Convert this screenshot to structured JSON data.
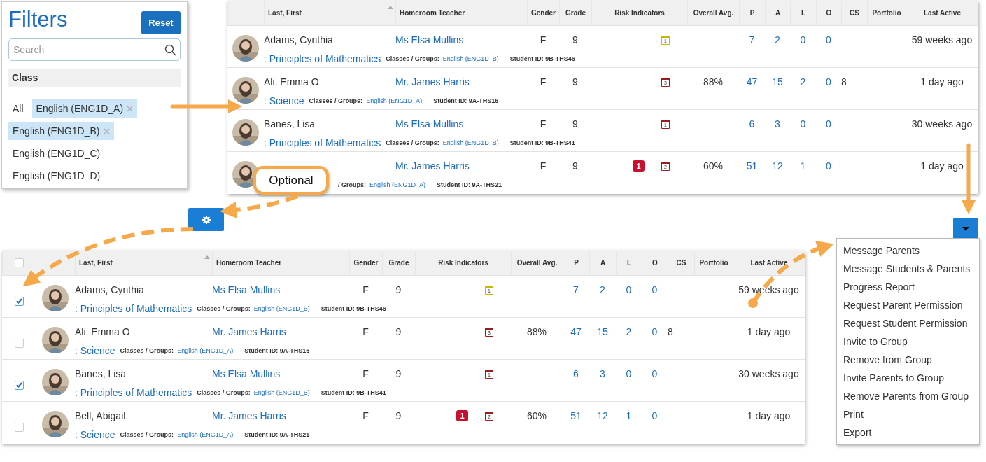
{
  "filters": {
    "title": "Filters",
    "reset_button": "Reset",
    "search": {
      "placeholder": "Search"
    },
    "section": "Class",
    "options": [
      {
        "label": "All",
        "selected": false
      },
      {
        "label": "English (ENG1D_A)",
        "selected": true
      },
      {
        "label": "English (ENG1D_B)",
        "selected": true
      },
      {
        "label": "English (ENG1D_C)",
        "selected": false
      },
      {
        "label": "English (ENG1D_D)",
        "selected": false
      }
    ]
  },
  "top_table": {
    "columns": [
      "Last, First",
      "Homeroom Teacher",
      "Gender",
      "Grade",
      "Risk Indicators",
      "Overall Avg.",
      "P",
      "A",
      "L",
      "O",
      "CS",
      "Portfolio",
      "Last Active"
    ],
    "rows": [
      {
        "name": "Adams, Cynthia",
        "teacher": "Ms Elsa Mullins",
        "gender": "F",
        "grade": "9",
        "calendar": {
          "count": "1",
          "color": "#c9b800"
        },
        "p": "7",
        "a": "2",
        "l": "0",
        "o": "0",
        "last_active": "59 weeks ago",
        "course": ": Principles of Mathematics",
        "classes_label": "Classes / Groups:",
        "class": "English (ENG1D_B)",
        "student_id": "Student ID: 9B-THS46"
      },
      {
        "name": "Ali, Emma O",
        "teacher": "Mr. James Harris",
        "gender": "F",
        "grade": "9",
        "calendar": {
          "count": "3",
          "color": "#9b1c1c"
        },
        "avg": "88%",
        "p": "47",
        "a": "15",
        "l": "2",
        "o": "0",
        "cs": "8",
        "last_active": "1 day ago",
        "course": ": Science",
        "classes_label": "Classes / Groups:",
        "class": "English (ENG1D_A)",
        "student_id": "Student ID: 9A-THS16"
      },
      {
        "name": "Banes, Lisa",
        "teacher": "Ms Elsa Mullins",
        "gender": "F",
        "grade": "9",
        "calendar": {
          "count": "1",
          "color": "#9b1c1c"
        },
        "p": "6",
        "a": "3",
        "l": "0",
        "o": "0",
        "last_active": "30 weeks ago",
        "course": ": Principles of Mathematics",
        "classes_label": "Classes / Groups:",
        "class": "English (ENG1D_B)",
        "student_id": "Student ID: 9B-THS41"
      },
      {
        "teacher": "Mr. James Harris",
        "gender": "F",
        "grade": "9",
        "alert": "1",
        "calendar": {
          "count": "2",
          "color": "#9b1c1c"
        },
        "avg": "60%",
        "p": "51",
        "a": "12",
        "l": "1",
        "o": "0",
        "last_active": "1 day ago",
        "classes_label": "/ Groups:",
        "class": "English (ENG1D_A)",
        "student_id": "Student ID: 9A-THS21"
      }
    ]
  },
  "callout": {
    "text": "Optional"
  },
  "dropdown_menu": {
    "items": [
      "Message Parents",
      "Message Students & Parents",
      "Progress Report",
      "Request Parent Permission",
      "Request Student Permission",
      "Invite to Group",
      "Remove from Group",
      "Invite Parents to Group",
      "Remove Parents from Group",
      "Print",
      "Export"
    ]
  },
  "bottom_table": {
    "header_checkbox": {
      "checked": false
    },
    "columns": [
      "Last, First",
      "Homeroom Teacher",
      "Gender",
      "Grade",
      "Risk Indicators",
      "Overall Avg.",
      "P",
      "A",
      "L",
      "O",
      "CS",
      "Portfolio",
      "Last Active"
    ],
    "rows": [
      {
        "checked": true,
        "name": "Adams, Cynthia",
        "teacher": "Ms Elsa Mullins",
        "gender": "F",
        "grade": "9",
        "calendar": {
          "count": "1",
          "color": "#c9b800"
        },
        "p": "7",
        "a": "2",
        "l": "0",
        "o": "0",
        "last_active": "59 weeks ago",
        "course": ": Principles of Mathematics",
        "classes_label": "Classes / Groups:",
        "class": "English (ENG1D_B)",
        "student_id": "Student ID: 9B-THS46"
      },
      {
        "checked": false,
        "name": "Ali, Emma O",
        "teacher": "Mr. James Harris",
        "gender": "F",
        "grade": "9",
        "calendar": {
          "count": "3",
          "color": "#9b1c1c"
        },
        "avg": "88%",
        "p": "47",
        "a": "15",
        "l": "2",
        "o": "0",
        "cs": "8",
        "last_active": "1 day ago",
        "course": ": Science",
        "classes_label": "Classes / Groups:",
        "class": "English (ENG1D_A)",
        "student_id": "Student ID: 9A-THS16"
      },
      {
        "checked": true,
        "name": "Banes, Lisa",
        "teacher": "Ms Elsa Mullins",
        "gender": "F",
        "grade": "9",
        "calendar": {
          "count": "1",
          "color": "#9b1c1c"
        },
        "p": "6",
        "a": "3",
        "l": "0",
        "o": "0",
        "last_active": "30 weeks ago",
        "course": ": Principles of Mathematics",
        "classes_label": "Classes / Groups:",
        "class": "English (ENG1D_B)",
        "student_id": "Student ID: 9B-THS41"
      },
      {
        "checked": false,
        "name": "Bell, Abigail",
        "teacher": "Mr. James Harris",
        "gender": "F",
        "grade": "9",
        "alert": "1",
        "calendar": {
          "count": "2",
          "color": "#9b1c1c"
        },
        "avg": "60%",
        "p": "51",
        "a": "12",
        "l": "1",
        "o": "0",
        "last_active": "1 day ago",
        "course": ": Science",
        "classes_label": "Classes / Groups:",
        "class": "English (ENG1D_A)",
        "student_id": "Student ID: 9A-THS21"
      }
    ]
  }
}
